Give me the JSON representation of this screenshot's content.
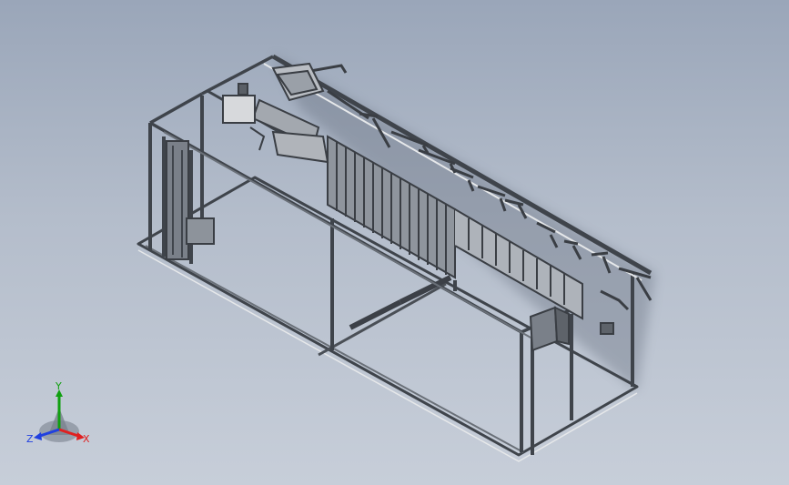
{
  "view": {
    "background_top": "#9aa6b9",
    "background_bottom": "#c7ced9",
    "model_color": "#5a5f66",
    "model_highlight": "#e6e8ea"
  },
  "triad": {
    "x_label": "X",
    "y_label": "Y",
    "z_label": "Z",
    "x_color": "#e02020",
    "y_color": "#10a010",
    "z_color": "#2040e0"
  }
}
